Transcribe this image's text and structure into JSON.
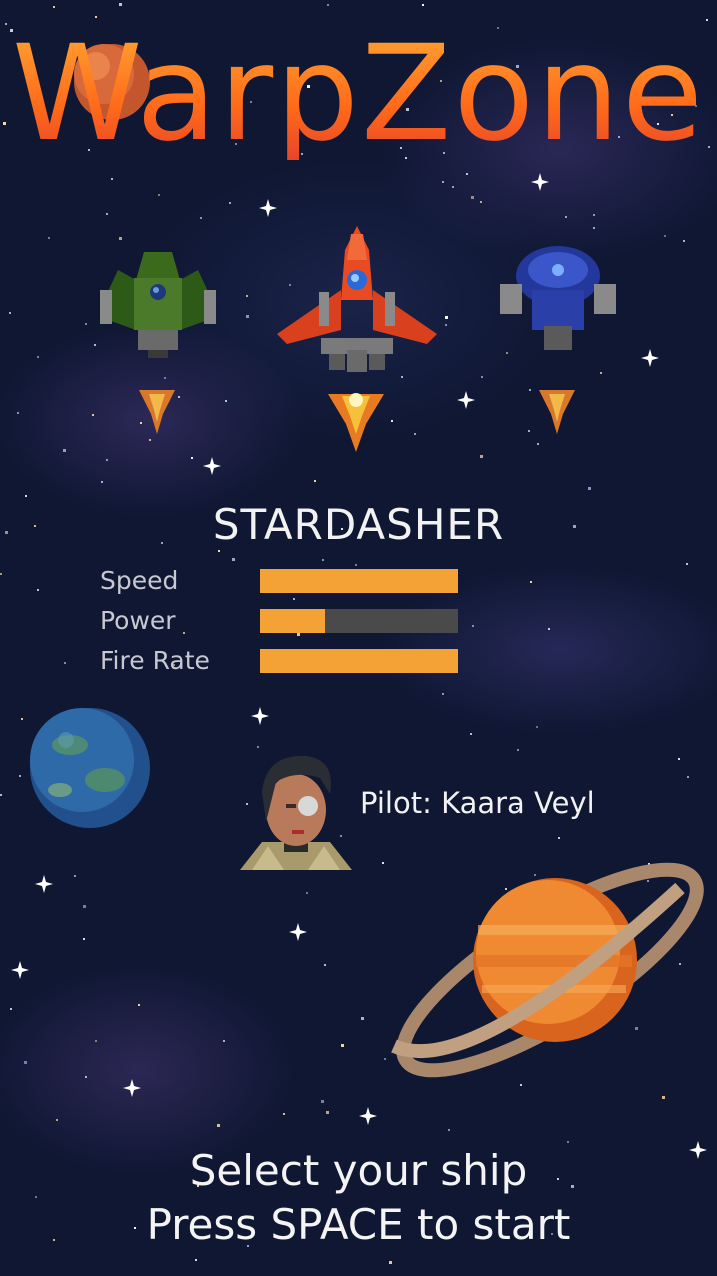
{
  "game": {
    "title": "WarpZone"
  },
  "ships": [
    {
      "name": "green-ship",
      "color": "#4a7a2a",
      "selected": false
    },
    {
      "name": "red-ship",
      "color": "#e8502a",
      "selected": true
    },
    {
      "name": "blue-ship",
      "color": "#2a44a8",
      "selected": false
    }
  ],
  "selected_ship": {
    "name": "STARDASHER",
    "stats": [
      {
        "label": "Speed",
        "value": 1.0
      },
      {
        "label": "Power",
        "value": 0.33
      },
      {
        "label": "Fire Rate",
        "value": 1.0
      }
    ]
  },
  "pilot": {
    "label": "Pilot: Kaara Veyl"
  },
  "prompts": {
    "line1": "Select your ship",
    "line2": "Press SPACE to start"
  },
  "colors": {
    "accent": "#f4a236",
    "title_gradient_top": "#ff9a2e",
    "title_gradient_bottom": "#e8452a",
    "background": "#0f1733",
    "stat_track": "#4a4a4a"
  }
}
